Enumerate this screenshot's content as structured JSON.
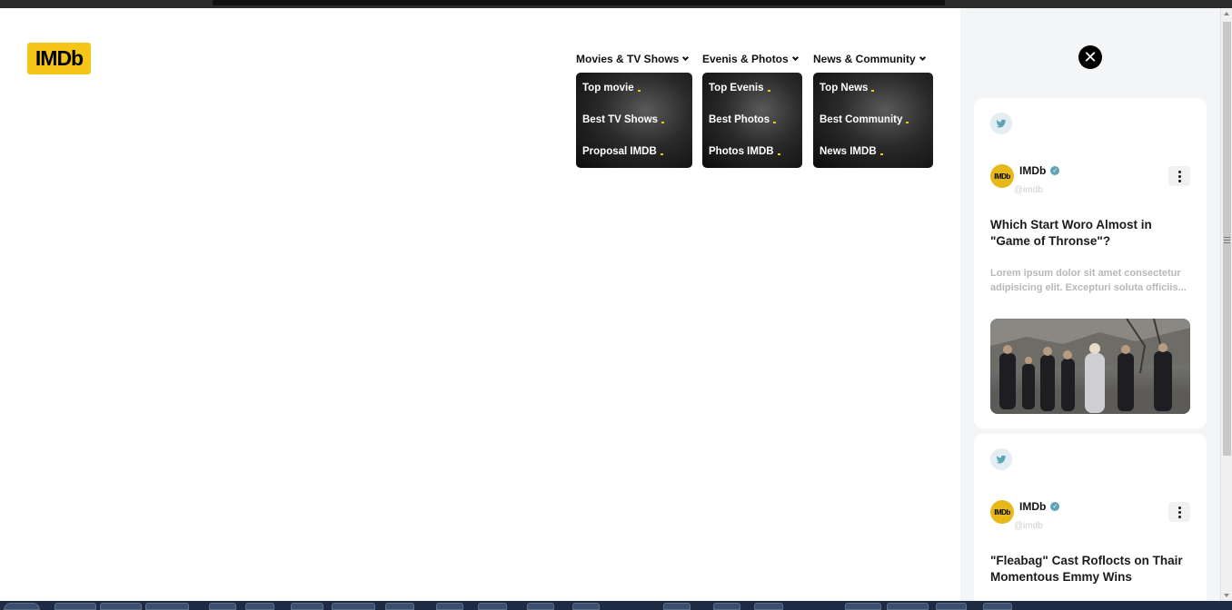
{
  "brand": {
    "logo_text": "IMDb",
    "accent": "#f5c518"
  },
  "nav": {
    "menus": [
      {
        "label": "Movies & TV Shows",
        "items": [
          "Top movie",
          "Best TV Shows",
          "Proposal IMDB"
        ]
      },
      {
        "label": "Evenis & Photos",
        "items": [
          "Top Evenis",
          "Best Photos",
          "Photos IMDB"
        ]
      },
      {
        "label": "News & Community",
        "items": [
          "Top News",
          "Best Community",
          "News IMDB"
        ]
      }
    ]
  },
  "sidepanel": {
    "close_icon": "close-icon",
    "cards": [
      {
        "source_icon": "twitter-icon",
        "avatar_text": "IMDb",
        "account_name": "IMDb",
        "handle": "@imdb",
        "headline": "Which Start Woro Almost in \"Game of Thronse\"?",
        "excerpt": "Lorem ipsum dolor sit amet consectetur adipisicing elit. Excepturi soluta officiis...",
        "image": "game-of-thrones-cast-photo"
      },
      {
        "source_icon": "twitter-icon",
        "avatar_text": "IMDb",
        "account_name": "IMDb",
        "handle": "@imdb",
        "headline": "\"Fleabag\" Cast Roflocts on Thair Momentous Emmy Wins"
      }
    ]
  }
}
